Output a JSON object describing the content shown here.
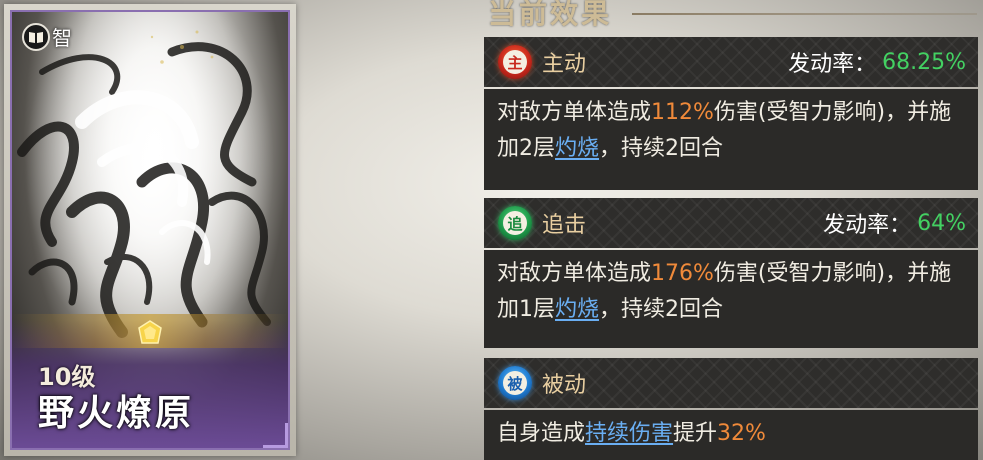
{
  "card": {
    "type_label": "智",
    "type_icon": "book-icon",
    "level": "10级",
    "name": "野火燎原",
    "frame_color": "#8a6fb0"
  },
  "section": {
    "title": "当前效果"
  },
  "effects": [
    {
      "icon": "active-flame-icon",
      "icon_char": "主",
      "color": "#c8281c",
      "type": "主动",
      "rate_label": "发动率：",
      "rate_value": "68.25%",
      "desc": {
        "p1": "对敌方单体造成",
        "pct": "112%",
        "p2": "伤害(受智力影响)，并施加2层",
        "link": "灼烧",
        "p3": "，持续2回合"
      }
    },
    {
      "icon": "pursuit-flame-icon",
      "icon_char": "追",
      "color": "#1f9a4a",
      "type": "追击",
      "rate_label": "发动率：",
      "rate_value": "64%",
      "desc": {
        "p1": "对敌方单体造成",
        "pct": "176%",
        "p2": "伤害(受智力影响)，并施加1层",
        "link": "灼烧",
        "p3": "，持续2回合"
      }
    },
    {
      "icon": "passive-flame-icon",
      "icon_char": "被",
      "color": "#1f7bd0",
      "type": "被动",
      "desc": {
        "p1": "自身造成",
        "link": "持续伤害",
        "p2": "提升",
        "pct": "32%"
      }
    }
  ],
  "colors": {
    "highlight": "#f08a3a",
    "link": "#6aaef2",
    "rate": "#43d162"
  }
}
